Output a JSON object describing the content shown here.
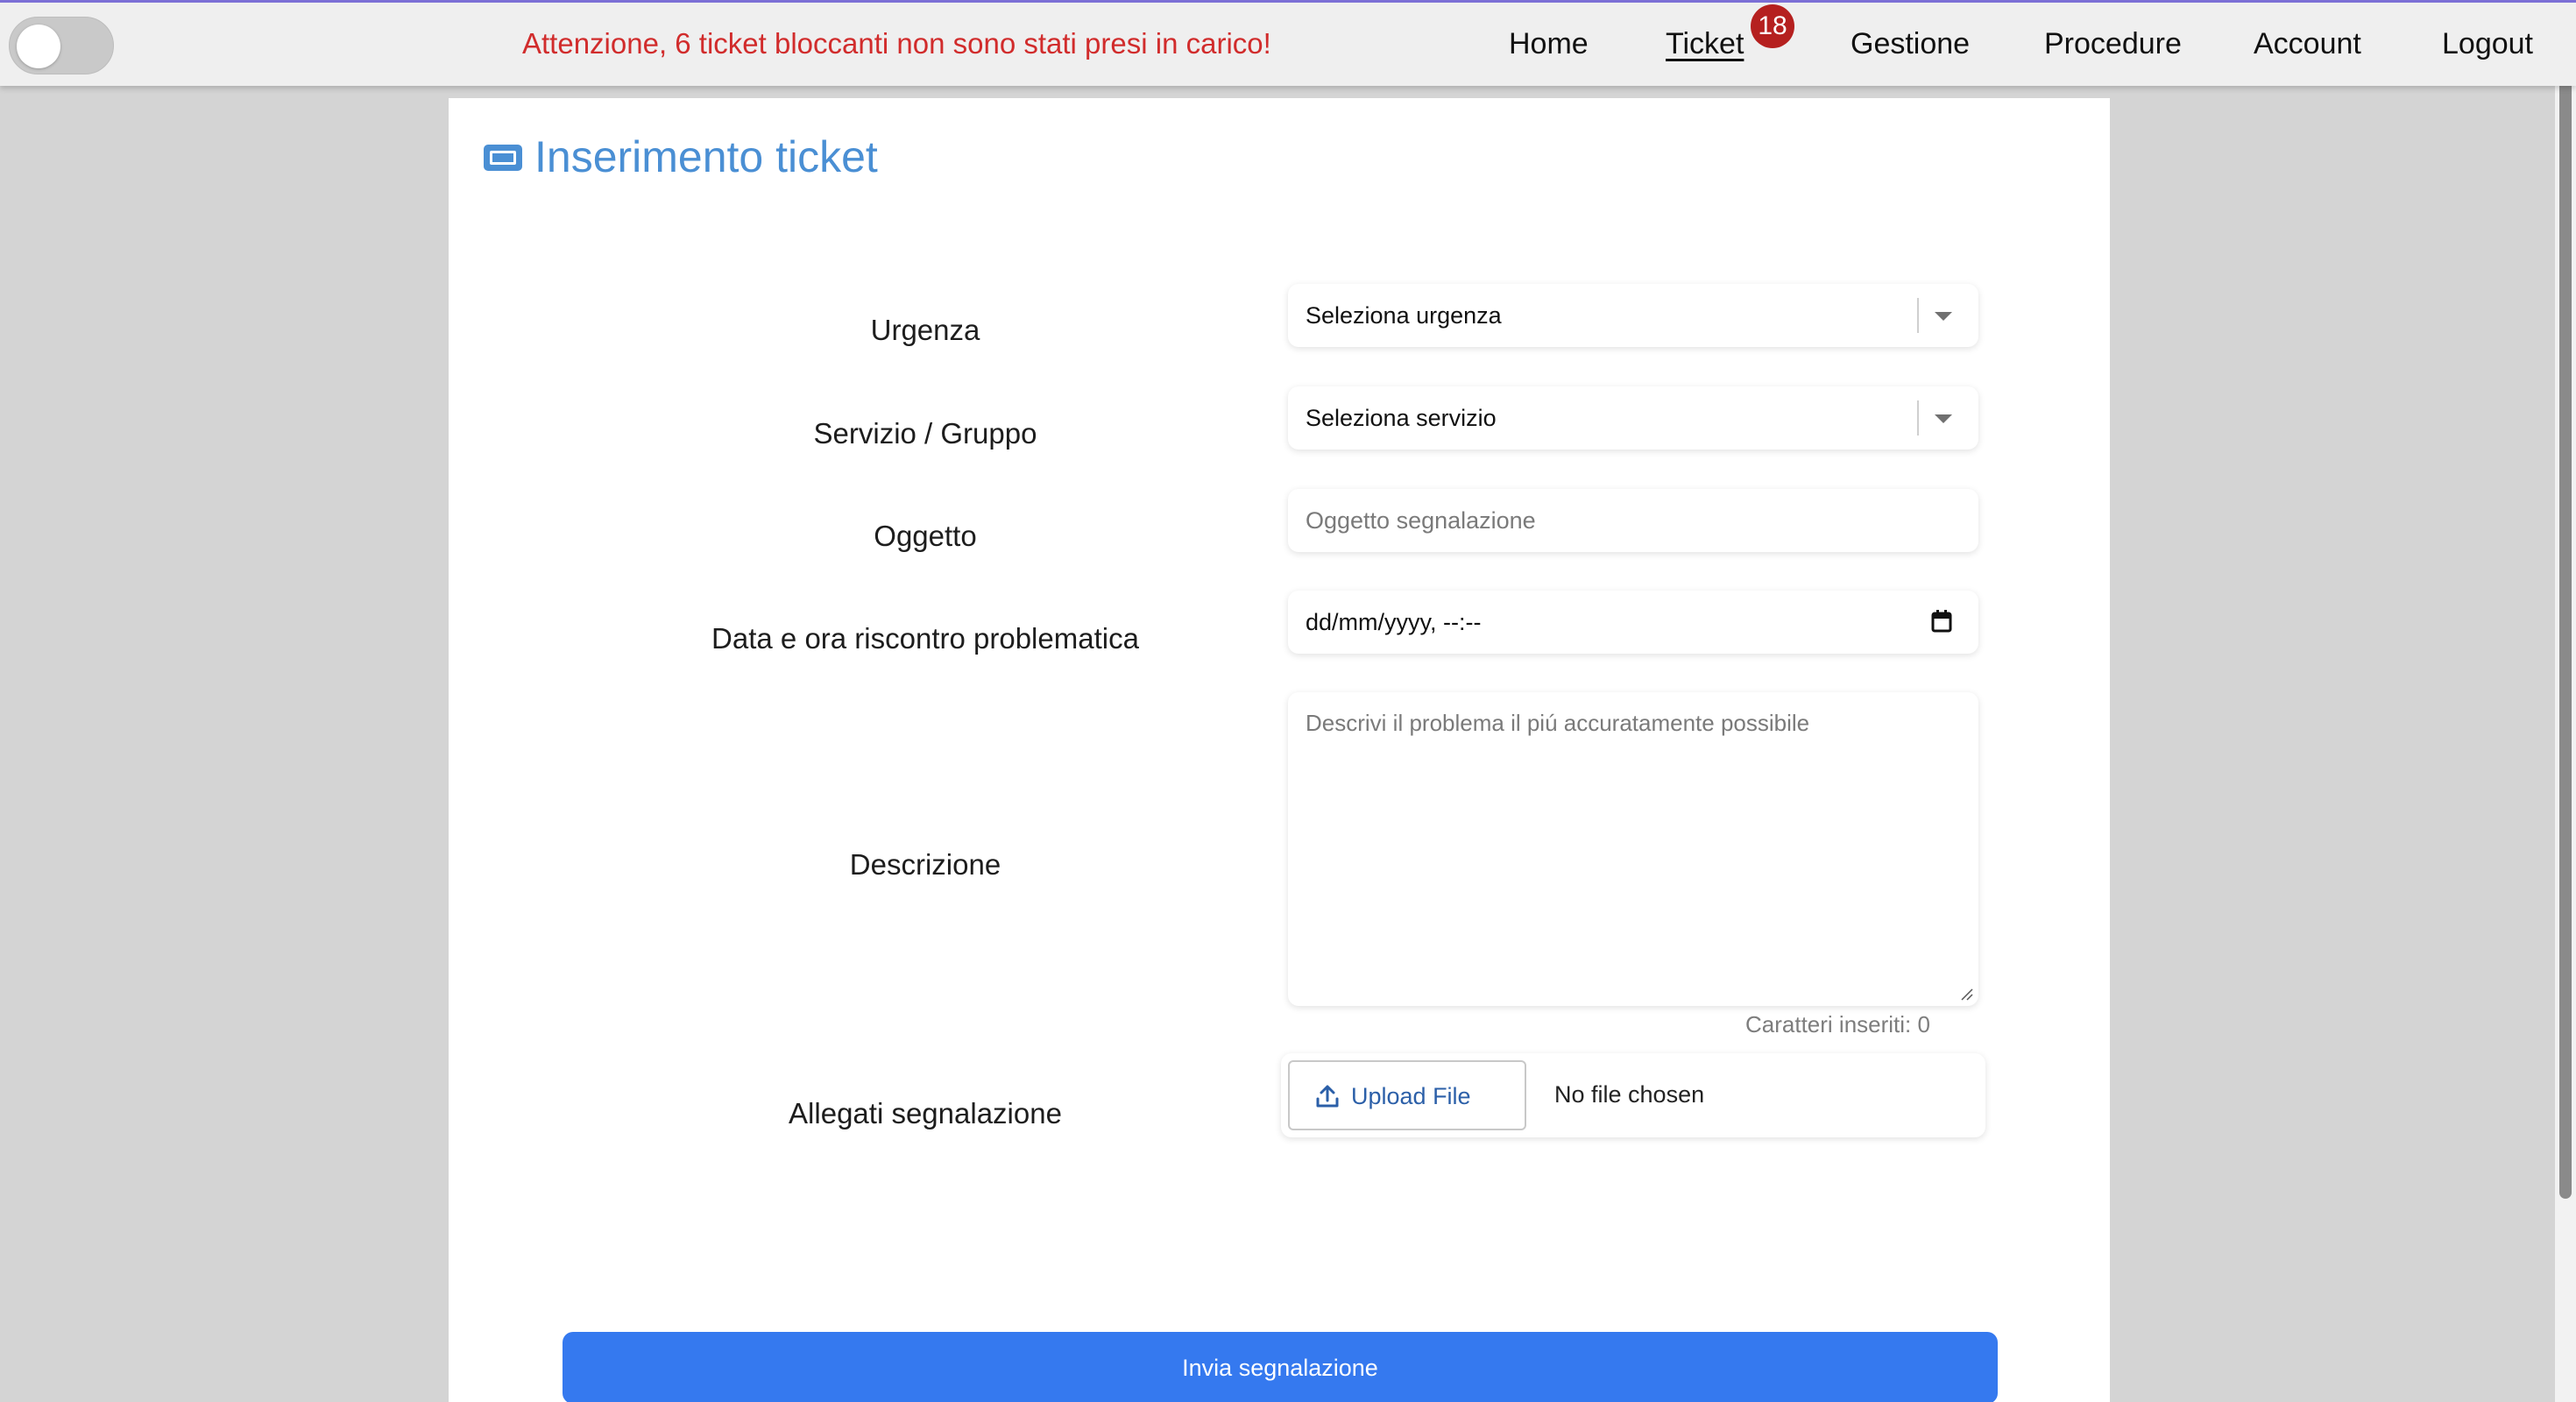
{
  "header": {
    "alert": "Attenzione, 6 ticket bloccanti non sono stati presi in carico!",
    "nav": [
      {
        "label": "Home"
      },
      {
        "label": "Ticket",
        "badge": "18",
        "active": true
      },
      {
        "label": "Gestione"
      },
      {
        "label": "Procedure"
      },
      {
        "label": "Account"
      },
      {
        "label": "Logout"
      }
    ],
    "toggle_on": false
  },
  "page": {
    "title": "Inserimento ticket",
    "icon": "ticket-icon"
  },
  "form": {
    "urgenza": {
      "label": "Urgenza",
      "value": "Seleziona urgenza"
    },
    "servizio": {
      "label": "Servizio / Gruppo",
      "value": "Seleziona servizio"
    },
    "oggetto": {
      "label": "Oggetto",
      "placeholder": "Oggetto segnalazione"
    },
    "data": {
      "label": "Data e ora riscontro problematica",
      "value": "dd/mm/yyyy, --:--"
    },
    "descrizione": {
      "label": "Descrizione",
      "placeholder": "Descrivi il problema il piú accuratamente possibile",
      "char_count": "Caratteri inseriti: 0"
    },
    "allegati": {
      "label": "Allegati segnalazione",
      "button": "Upload File",
      "status": "No file chosen"
    },
    "submit": "Invia segnalazione"
  },
  "colors": {
    "alert": "#d12c2c",
    "title": "#4a8fd4",
    "badge": "#b5201f",
    "submit": "#3579ef"
  }
}
